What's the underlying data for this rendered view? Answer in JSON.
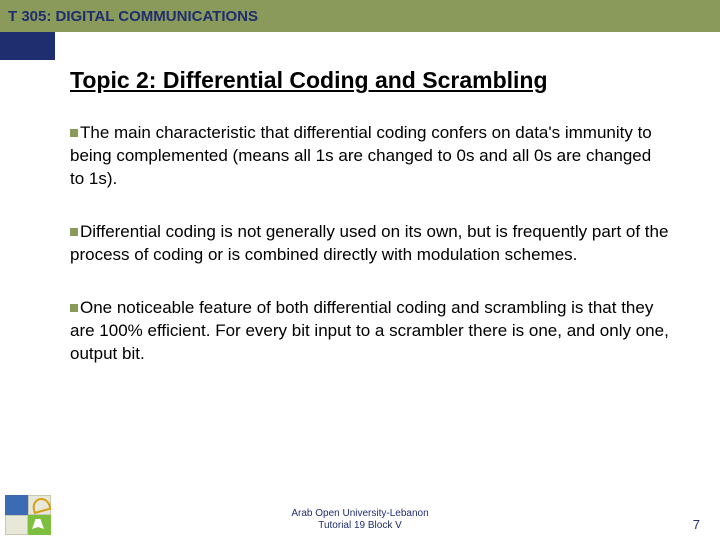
{
  "header": {
    "course": "T 305: DIGITAL COMMUNICATIONS"
  },
  "title": "Topic 2: Differential Coding and Scrambling",
  "bullets": {
    "b1": "The main characteristic that differential coding confers on data's immunity to being complemented (means all 1s are changed to 0s and all 0s are changed to 1s).",
    "b2": "Differential coding is not generally used on its own, but is frequently part of the process of coding or is combined directly with modulation schemes.",
    "b3": "One noticeable feature of both differential coding and scrambling is that they are 100% efficient. For every bit input to a scrambler there is one, and only one, output bit."
  },
  "footer": {
    "line1": "Arab Open University-Lebanon",
    "line2": "Tutorial 19 Block V",
    "page": "7"
  }
}
